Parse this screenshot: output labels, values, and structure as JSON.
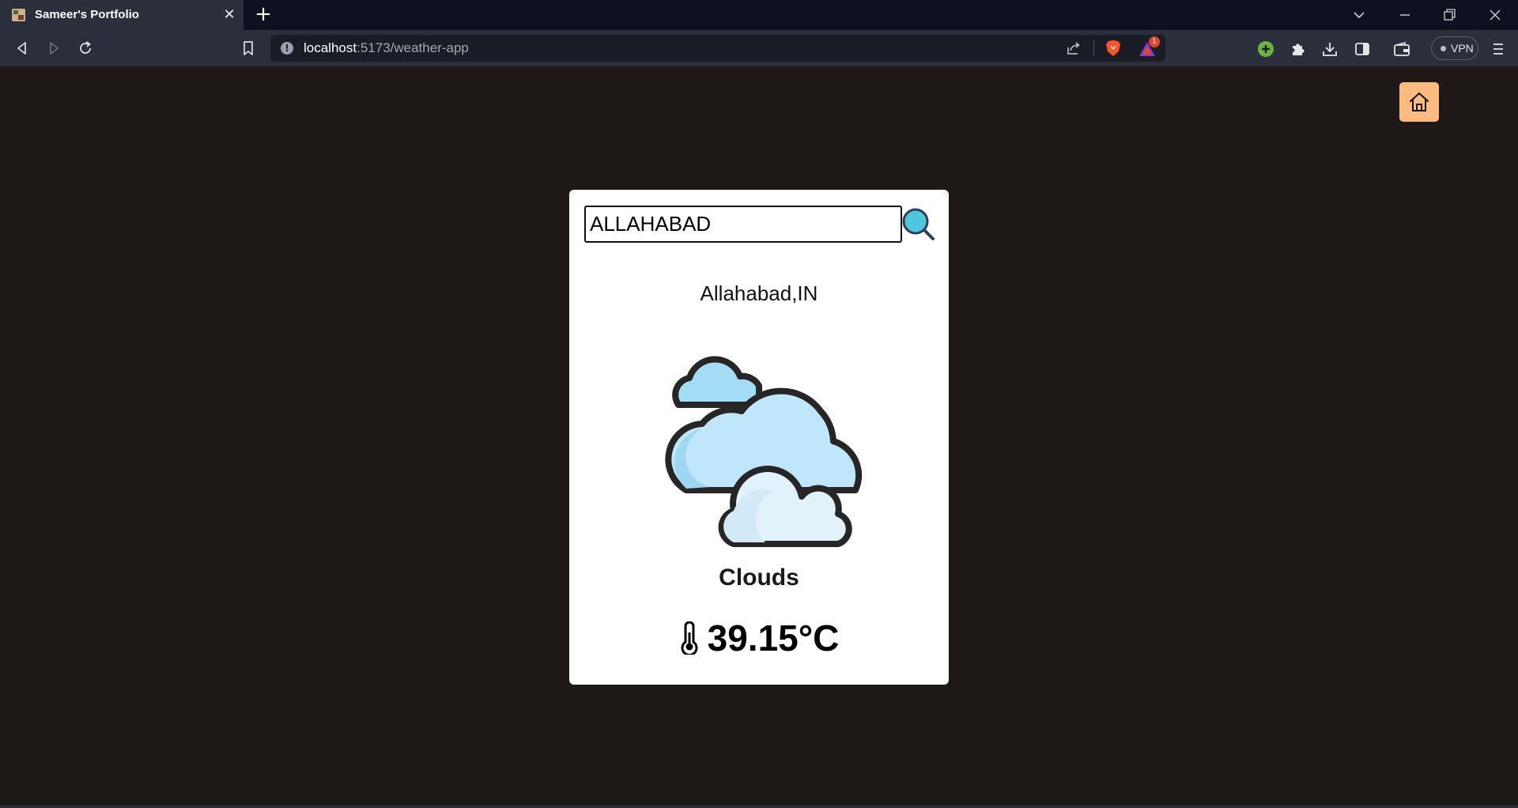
{
  "browser": {
    "tab_title": "Sameer's Portfolio",
    "url_host": "localhost",
    "url_rest": ":5173/weather-app",
    "rewards_count": "1",
    "vpn_label": "VPN"
  },
  "app": {
    "search_value": "ALLAHABAD",
    "location": "Allahabad,IN",
    "condition": "Clouds",
    "temperature": "39.15°C"
  },
  "colors": {
    "page_bg": "#1e1916",
    "home_button": "#ffbb7f",
    "card_bg": "#ffffff",
    "search_icon_fill": "#4fc6dc"
  },
  "icons": {
    "weather": "clouds-icon",
    "search": "search-icon",
    "home": "home-icon",
    "temperature": "thermometer-icon"
  }
}
